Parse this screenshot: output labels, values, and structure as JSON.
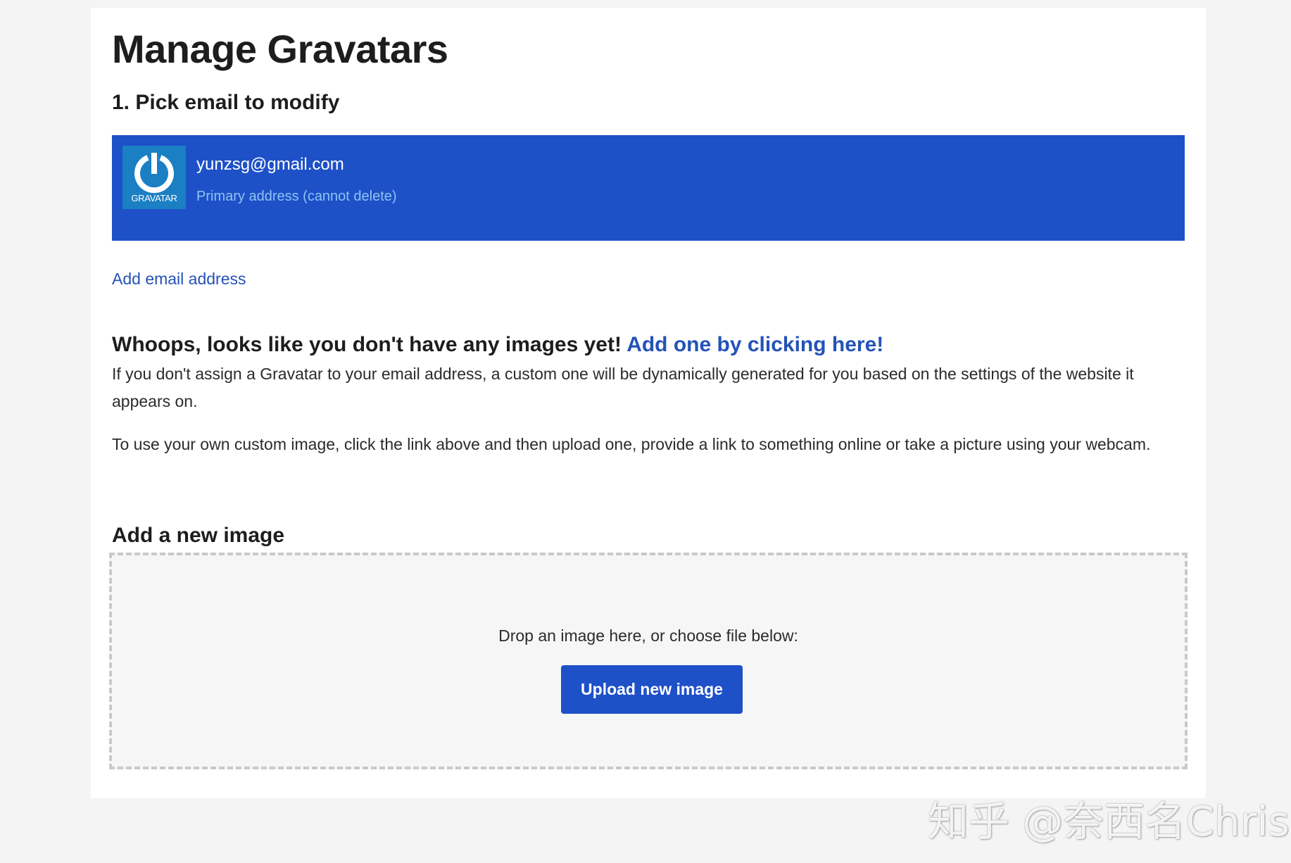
{
  "page": {
    "title": "Manage Gravatars"
  },
  "step": {
    "title": "1. Pick email to modify"
  },
  "email": {
    "address": "yunzsg@gmail.com",
    "note": "Primary address (cannot delete)",
    "avatar_caption": "GRAVATAR",
    "avatar_icon": "gravatar-logo-icon"
  },
  "add_email": {
    "label": "Add email address"
  },
  "empty_state": {
    "heading": "Whoops, looks like you don't have any images yet! ",
    "link": "Add one by clicking here!",
    "para1": "If you don't assign a Gravatar to your email address, a custom one will be dynamically generated for you based on the settings of the website it appears on.",
    "para2": "To use your own custom image, click the link above and then upload one, provide a link to something online or take a picture using your webcam."
  },
  "add_image": {
    "title": "Add a new image",
    "drop_text": "Drop an image here, or choose file below:",
    "button_label": "Upload new image"
  },
  "watermark": {
    "text": "知乎 @奈西名Chris"
  },
  "colors": {
    "accent": "#1e50c8",
    "link": "#2452b8",
    "note": "#8ec3f2",
    "avatar_bg": "#1b7fc4"
  }
}
